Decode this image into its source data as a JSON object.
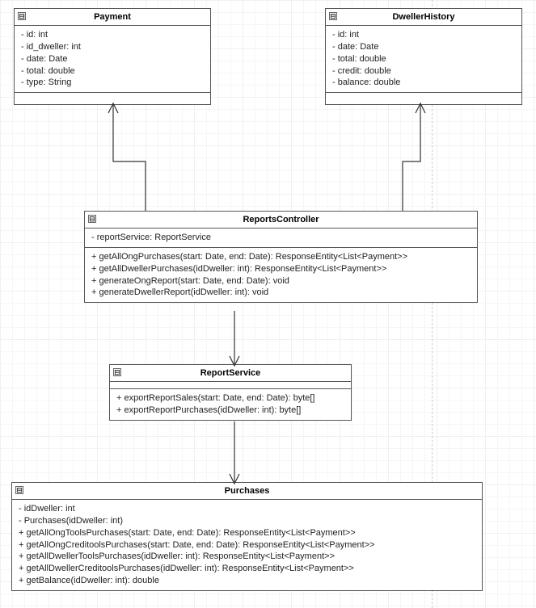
{
  "classes": {
    "payment": {
      "name": "Payment",
      "attrs": [
        "- id: int",
        "- id_dweller: int",
        "- date: Date",
        "- total: double",
        "- type: String"
      ]
    },
    "dwellerHistory": {
      "name": "DwellerHistory",
      "attrs": [
        "- id: int",
        "- date: Date",
        "- total: double",
        "- credit: double",
        "- balance: double"
      ]
    },
    "reportsController": {
      "name": "ReportsController",
      "attrs": [
        "- reportService: ReportService"
      ],
      "methods": [
        "+ getAllOngPurchases(start: Date, end: Date): ResponseEntity<List<Payment>>",
        "+ getAllDwellerPurchases(idDweller: int): ResponseEntity<List<Payment>>",
        "+ generateOngReport(start: Date, end: Date): void",
        "+ generateDwellerReport(idDweller: int): void"
      ]
    },
    "reportService": {
      "name": "ReportService",
      "methods": [
        "+ exportReportSales(start: Date, end: Date): byte[]",
        "+ exportReportPurchases(idDweller: int): byte[]"
      ]
    },
    "purchases": {
      "name": "Purchases",
      "attrs": [
        "- idDweller: int",
        "- Purchases(idDweller: int)"
      ],
      "methods": [
        "+ getAllOngToolsPurchases(start: Date, end: Date): ResponseEntity<List<Payment>>",
        "+ getAllOngCreditoolsPurchases(start: Date, end: Date): ResponseEntity<List<Payment>>",
        "+ getAllDwellerToolsPurchases(idDweller: int): ResponseEntity<List<Payment>>",
        "+ getAllDwellerCreditoolsPurchases(idDweller: int): ResponseEntity<List<Payment>>",
        "+ getBalance(idDweller: int): double"
      ]
    }
  },
  "toggle_glyph": "⊟"
}
